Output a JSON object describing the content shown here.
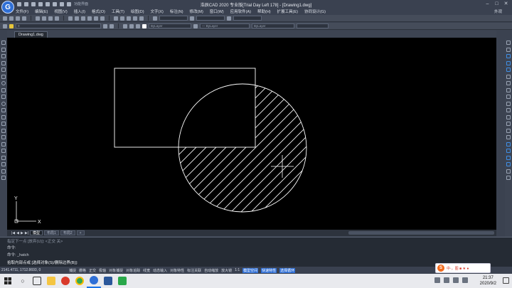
{
  "app": {
    "logo_letter": "G",
    "title": "浩辰CAD 2020 专业版[Trial Day Left 178] - [Drawing1.dwg]",
    "quick_access_label": "功能界面"
  },
  "menubar": {
    "items": [
      "文件(F)",
      "编辑(E)",
      "视图(V)",
      "插入(I)",
      "格式(O)",
      "工具(T)",
      "绘图(D)",
      "文字(X)",
      "标注(N)",
      "修改(M)",
      "窗口(W)",
      "应用软件(A)",
      "帮助(H)",
      "扩展工具(E)",
      "协同设计(G)"
    ],
    "right_label": "外观"
  },
  "toolbar2": {
    "layer_combo": "0",
    "color_combo": "ByLayer",
    "linetype_combo": "— ByLayer",
    "lineweight_combo": "ByLayer"
  },
  "document_tab": "Drawing1.dwg",
  "layout_tabs": [
    "模型",
    "布局1",
    "布局2"
  ],
  "command": {
    "line1": "指定下一点 [放弃(U)]: <正交 关>",
    "line2": "命令:",
    "line3": "命令: _hatch",
    "prompt": "拾取内部点或 [选择对象(S)/删除边界(B)]:"
  },
  "statusbar": {
    "coords": "2141.4711, 1712.8693, 0",
    "items": [
      "捕捉",
      "栅格",
      "正交",
      "极轴",
      "对象捕捉",
      "对象追踪",
      "线宽",
      "动态输入",
      "对象特性",
      "标注关联",
      "自动缩放",
      "放大镜"
    ],
    "scale": "1:1",
    "highlight_items": [
      "模型空间",
      "快速特性",
      "选择循环"
    ]
  },
  "taskbar": {
    "time": "21:37",
    "date": "2020/9/2",
    "ime_label": "S",
    "ime_text": "中·，图 ■ ★ ●"
  },
  "colors": {
    "accent": "#2f6fd6",
    "canvas_bg": "#000000",
    "drawing_lines": "#ffffff"
  }
}
